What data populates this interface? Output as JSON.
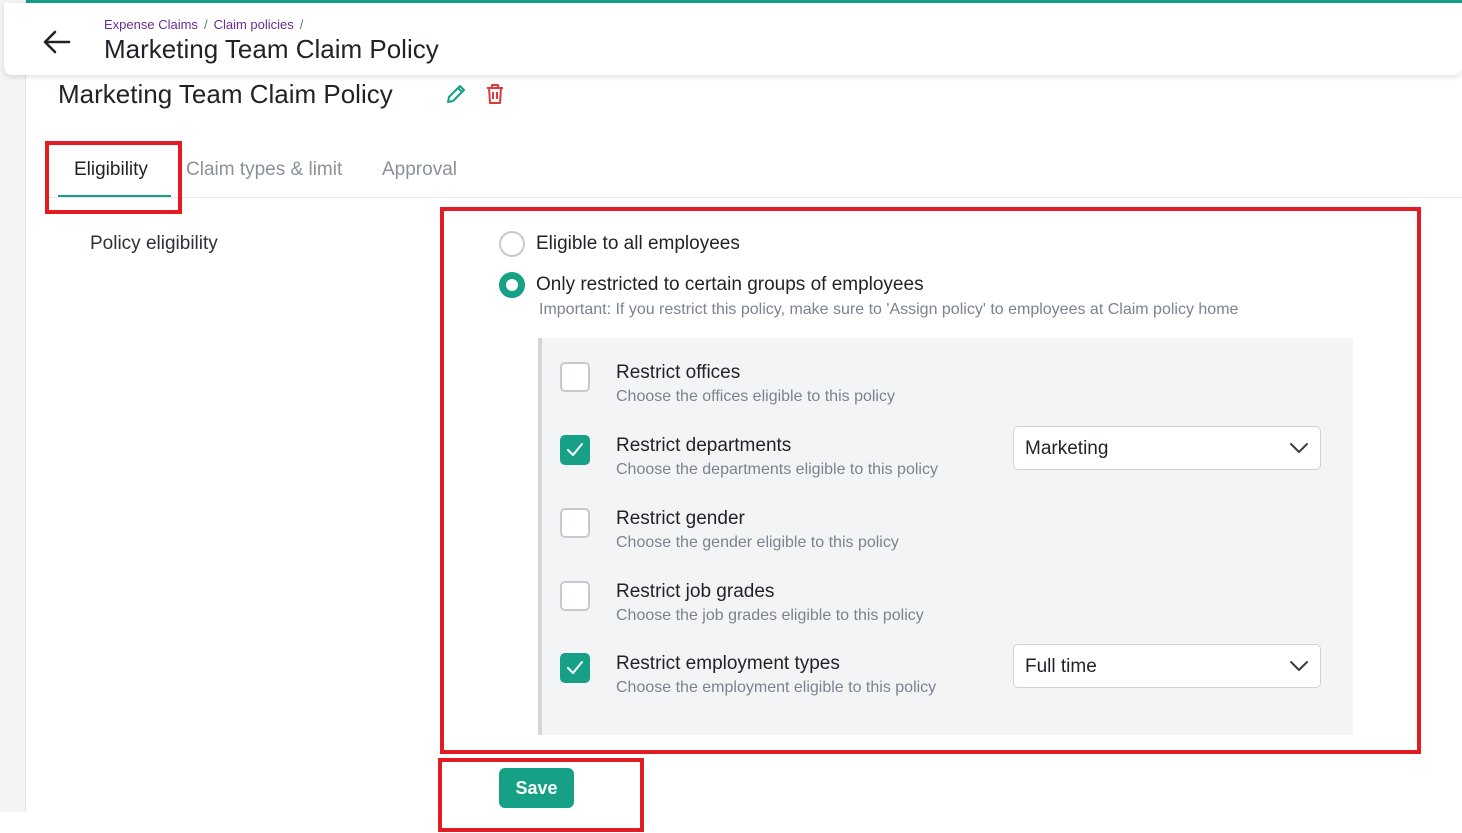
{
  "colors": {
    "accent": "#16a085",
    "breadcrumb": "#6b2c91",
    "delete": "#e03a3a",
    "highlight": "#e21c23"
  },
  "header": {
    "back_icon": "arrow-left-icon",
    "breadcrumb": [
      "Expense Claims",
      "Claim policies"
    ],
    "breadcrumb_separator": "/",
    "title": "Marketing Team Claim Policy"
  },
  "page": {
    "title": "Marketing Team Claim Policy",
    "edit_icon": "pencil-icon",
    "delete_icon": "trash-icon"
  },
  "tabs": [
    {
      "label": "Eligibility",
      "active": true
    },
    {
      "label": "Claim types & limit",
      "active": false
    },
    {
      "label": "Approval",
      "active": false
    }
  ],
  "eligibility": {
    "section_label": "Policy eligibility",
    "options": [
      {
        "label": "Eligible to all employees",
        "selected": false
      },
      {
        "label": "Only restricted to certain groups of employees",
        "selected": true
      }
    ],
    "note": "Important: If you restrict this policy, make sure to 'Assign policy' to employees at Claim policy home",
    "restrictions": [
      {
        "title": "Restrict offices",
        "subtitle": "Choose the offices eligible to this policy",
        "checked": false
      },
      {
        "title": "Restrict departments",
        "subtitle": "Choose the departments eligible to this policy",
        "checked": true,
        "value": "Marketing"
      },
      {
        "title": "Restrict gender",
        "subtitle": "Choose the gender eligible to this policy",
        "checked": false
      },
      {
        "title": "Restrict job grades",
        "subtitle": "Choose the job grades eligible to this policy",
        "checked": false
      },
      {
        "title": "Restrict employment types",
        "subtitle": "Choose the employment eligible to this policy",
        "checked": true,
        "value": "Full time"
      }
    ]
  },
  "actions": {
    "save_label": "Save"
  }
}
